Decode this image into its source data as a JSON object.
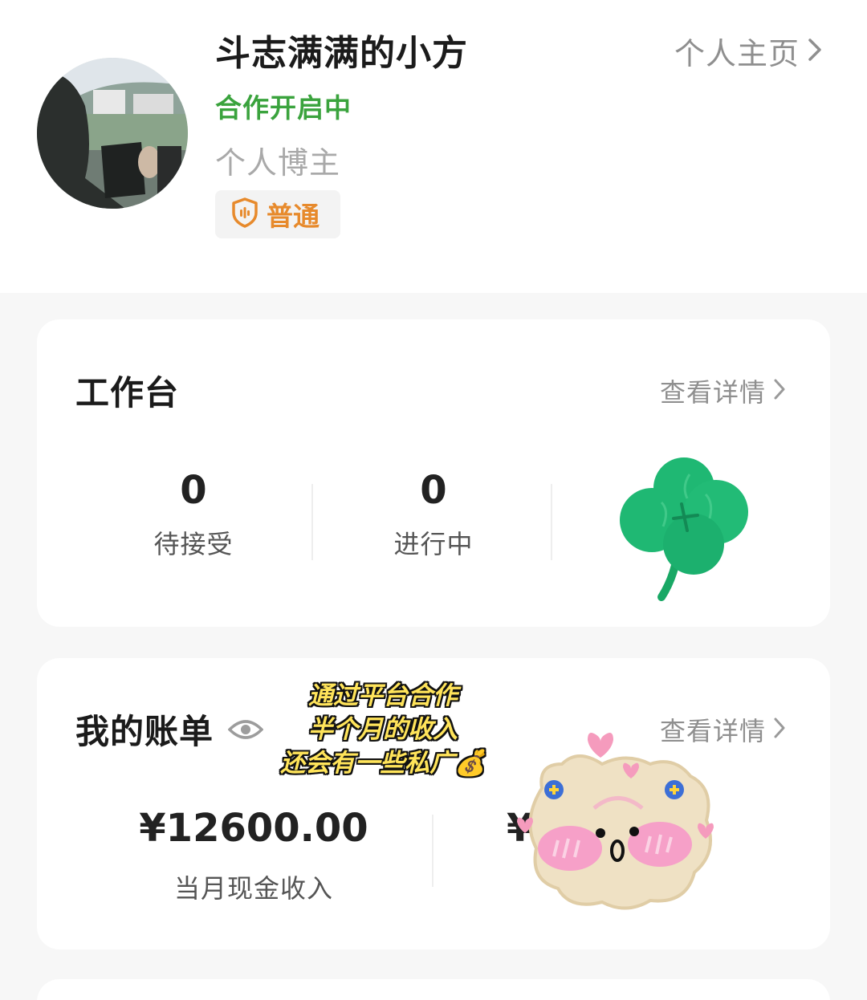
{
  "profile": {
    "name": "斗志满满的小方",
    "status": "合作开启中",
    "role": "个人博主",
    "badge_label": "普通",
    "homepage_link": "个人主页"
  },
  "workbench": {
    "title": "工作台",
    "detail_link": "查看详情",
    "stats": [
      {
        "value": "0",
        "label": "待接受"
      },
      {
        "value": "0",
        "label": "进行中"
      }
    ]
  },
  "bill": {
    "title": "我的账单",
    "detail_link": "查看详情",
    "monthly_cash_income": "¥12600.00",
    "monthly_cash_income_label": "当月现金收入",
    "second_amount_visible_prefix": "¥"
  },
  "overlay": {
    "caption_lines": [
      "通过平台合作",
      "半个月的收入",
      "还会有一些私广💰"
    ]
  },
  "colors": {
    "status_green": "#3aa33d",
    "badge_orange": "#e78a2c",
    "clover_green": "#1fb873",
    "background": "#f7f7f7"
  },
  "icons": [
    "chevron-right-icon",
    "shield-icon",
    "eye-icon",
    "clover-sticker",
    "pig-sticker"
  ]
}
